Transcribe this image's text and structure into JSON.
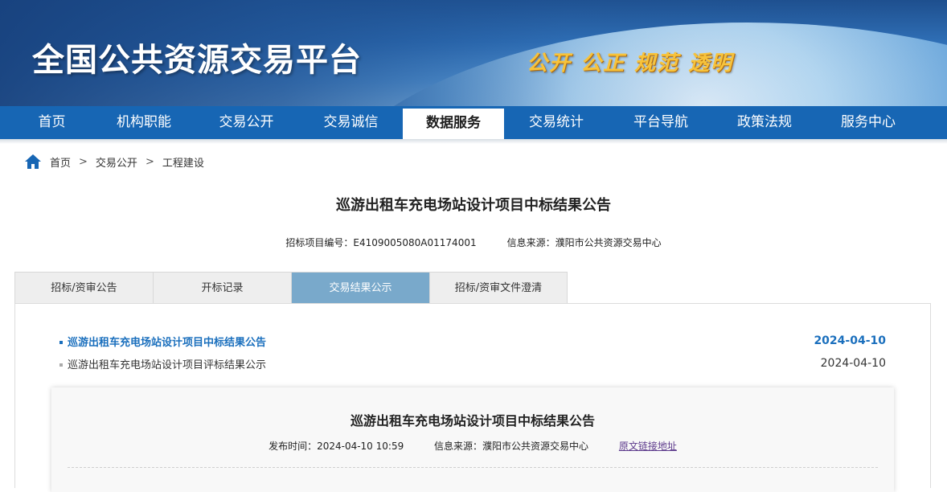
{
  "header": {
    "title": "全国公共资源交易平台",
    "slogan": "公开 公正 规范 透明"
  },
  "nav": {
    "items": [
      "首页",
      "机构职能",
      "交易公开",
      "交易诚信",
      "数据服务",
      "交易统计",
      "平台导航",
      "政策法规",
      "服务中心"
    ],
    "active": "数据服务"
  },
  "breadcrumb": {
    "items": [
      "首页",
      "交易公开",
      "工程建设"
    ],
    "separator": ">"
  },
  "page": {
    "title": "巡游出租车充电场站设计项目中标结果公告",
    "project_no": "招标项目编号：E4109005080A01174001",
    "source": "信息来源：濮阳市公共资源交易中心"
  },
  "tabs": {
    "items": [
      "招标/资审公告",
      "开标记录",
      "交易结果公示",
      "招标/资审文件澄清"
    ],
    "active": "交易结果公示"
  },
  "list": [
    {
      "name": "巡游出租车充电场站设计项目中标结果公告",
      "date": "2024-04-10",
      "active": true
    },
    {
      "name": "巡游出租车充电场站设计项目评标结果公示",
      "date": "2024-04-10",
      "active": false
    }
  ],
  "detail": {
    "title": "巡游出租车充电场站设计项目中标结果公告",
    "publish_time": "发布时间：2024-04-10 10:59",
    "source": "信息来源：濮阳市公共资源交易中心",
    "original_link": "原文链接地址"
  },
  "colors": {
    "nav_bg": "#1766b4",
    "active_link": "#1a6fbd",
    "active_tab": "#79a9cb",
    "slogan": "#f7c33b"
  }
}
